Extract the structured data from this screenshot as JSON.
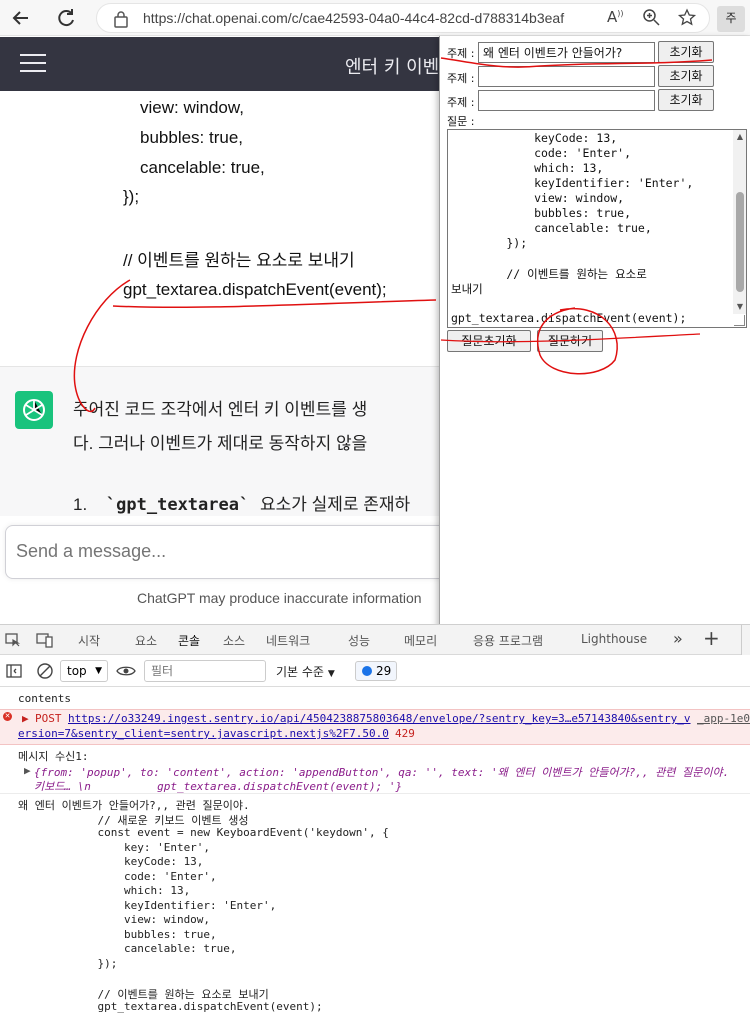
{
  "browser": {
    "url": "https://chat.openai.com/c/cae42593-04a0-44c4-82cd-d788314b3eaf",
    "profile_label": "주"
  },
  "chat": {
    "title": "엔터 키 이벤",
    "code_lines": [
      "view: window,",
      "bubbles: true,",
      "cancelable: true,",
      "});",
      "// 이벤트를 원하는 요소로 보내기",
      "gpt_textarea.dispatchEvent(event);"
    ],
    "answer_lines": [
      "주어진 코드 조각에서 엔터 키 이벤트를 생",
      "다. 그러나 이벤트가 제대로 동작하지 않을"
    ],
    "list_item": {
      "number": "1.",
      "code": "`gpt_textarea`",
      "text": "요소가 실제로 존재하"
    },
    "composer_placeholder": "Send a message...",
    "disclaimer": "ChatGPT may produce inaccurate information"
  },
  "popup": {
    "subject_label": "주제 :",
    "subjects": [
      "왜 엔터 이벤트가 안들어가?",
      "",
      ""
    ],
    "reset_label": "초기화",
    "question_label": "질문 :",
    "question_lines": [
      "            keyCode: 13,",
      "            code: 'Enter',",
      "            which: 13,",
      "            keyIdentifier: 'Enter',",
      "            view: window,",
      "            bubbles: true,",
      "            cancelable: true,",
      "        });",
      "",
      "        // 이벤트를 원하는 요소로",
      "보내기",
      "",
      "gpt_textarea.dispatchEvent(event);"
    ],
    "reset_question_label": "질문초기화",
    "ask_label": "질문하기"
  },
  "devtools": {
    "tabs": [
      "시작",
      "요소",
      "콘솔",
      "소스",
      "네트워크",
      "성능",
      "메모리",
      "응용 프로그램",
      "Lighthouse"
    ],
    "active_tab": "콘솔",
    "context": "top",
    "filter_placeholder": "필터",
    "level": "기본 수준",
    "issue_count": "29",
    "console": {
      "log1": "contents",
      "error_method": "POST",
      "error_url": "https://o33249.ingest.sentry.io/api/4504238875803648/envelope/?sentry_key=3…e57143840&sentry_v",
      "error_url2": "ersion=7&sentry_client=sentry.javascript.nextjs%2F7.50.0",
      "error_code": "429",
      "error_source": "_app-1e0",
      "msg_header": "메시지 수신1:",
      "obj_line1": "{from: 'popup', to: 'content', action: 'appendButton', qa: '', text: '왜 엔터 이벤트가 안들어가?,, 관련 질문이야.",
      "obj_line2": "키보드… \\n          gpt_textarea.dispatchEvent(event); '}",
      "text_lines": [
        "왜 엔터 이벤트가 안들어가?,, 관련 질문이야.",
        "            // 새로운 키보드 이벤트 생성",
        "            const event = new KeyboardEvent('keydown', {",
        "                key: 'Enter',",
        "                keyCode: 13,",
        "                code: 'Enter',",
        "                which: 13,",
        "                keyIdentifier: 'Enter',",
        "                view: window,",
        "                bubbles: true,",
        "                cancelable: true,",
        "            });",
        "",
        "            // 이벤트를 원하는 요소로 보내기",
        "            gpt_textarea.dispatchEvent(event);"
      ]
    }
  },
  "colors": {
    "header_bg": "#343541",
    "gpt_green": "#19c37d",
    "annotation_red": "#e01010",
    "devtools_accent": "#1a73e8"
  }
}
